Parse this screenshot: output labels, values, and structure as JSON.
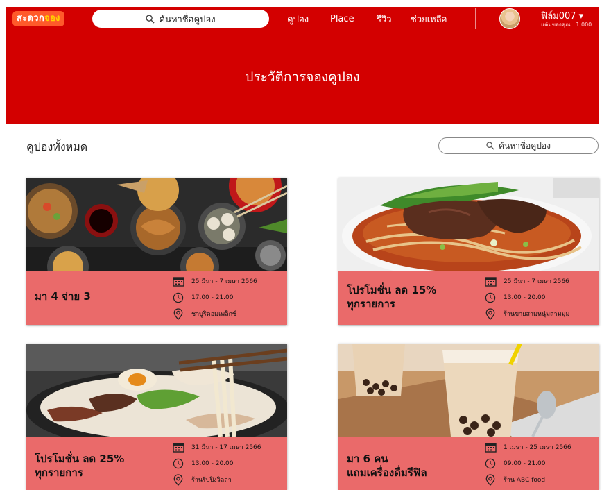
{
  "header": {
    "logo_part1": "สะดวก",
    "logo_part2": "จอง",
    "search_placeholder": "ค้นหาชื่อคูปอง",
    "nav": {
      "coupon": "คูปอง",
      "place": "Place",
      "review": "รีวิว",
      "help": "ช่วยเหลือ"
    },
    "user": {
      "name": "ฟิล์ม007 ▾",
      "points": "แต้มของคุณ : 1,000"
    }
  },
  "banner": {
    "title": "ประวัติการจองคูปอง"
  },
  "content": {
    "title": "คูปองทั้งหมด",
    "search_placeholder": "ค้นหาชื่อคูปอง"
  },
  "cards": [
    {
      "title_line1": "มา 4 จ่าย 3",
      "title_line2": "",
      "date": "25 มีนา - 7 เมษา 2566",
      "time": "17.00 - 21.00",
      "place": "ชาบูริคอมเพล็กซ์",
      "image": "asian-food-spread"
    },
    {
      "title_line1": "โปรโมชั่น ลด 15%",
      "title_line2": "ทุกรายการ",
      "date": "25 มีนา - 7 เมษา 2566",
      "time": "13.00 - 20.00",
      "place": "ร้านขายสามหนุ่มสามมุม",
      "image": "beef-noodle-soup"
    },
    {
      "title_line1": "โปรโมชั่น ลด 25%",
      "title_line2": "ทุกรายการ",
      "date": "31 มีนา - 17 เมษา 2566",
      "time": "13.00 - 20.00",
      "place": "ร้านรีบปิงวิลล่า",
      "image": "ramen-bowl"
    },
    {
      "title_line1": "มา 6 คน",
      "title_line2": "แถมเครื่องดื่มรีฟิล",
      "date": "1 เมษา - 25 เมษา 2566",
      "time": "09.00 - 21.00",
      "place": "ร้าน ABC food",
      "image": "bubble-milk-tea"
    }
  ],
  "colors": {
    "brand_red": "#d30000",
    "card_info": "#ea6a6a",
    "logo_orange": "#ff5a2a"
  }
}
